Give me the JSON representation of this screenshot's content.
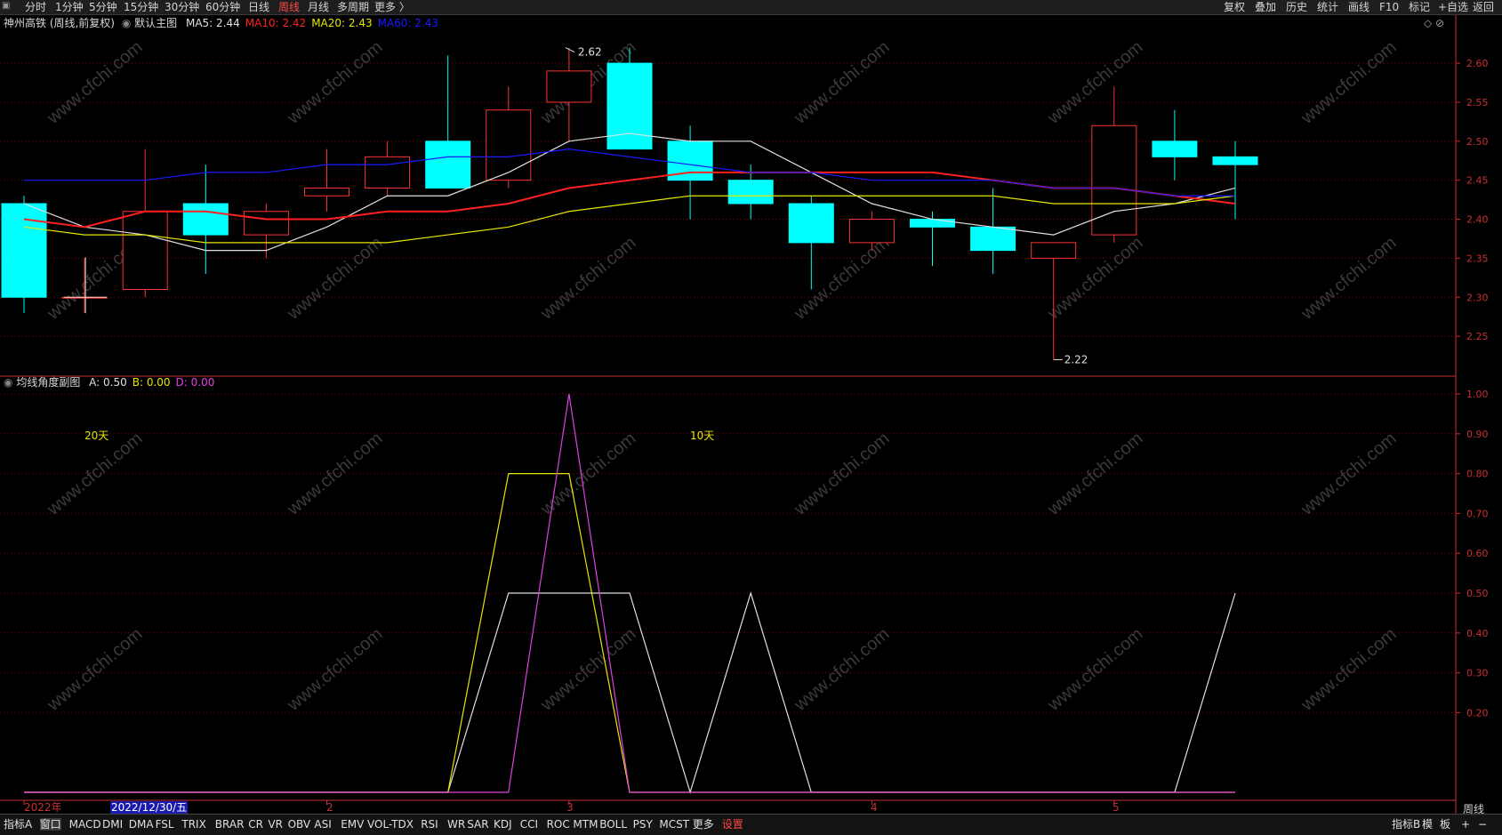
{
  "topbar": {
    "left_items": [
      "分时",
      "1分钟",
      "5分钟",
      "15分钟",
      "30分钟",
      "60分钟",
      "日线",
      "周线",
      "月线",
      "多周期",
      "更多 〉"
    ],
    "active": "周线",
    "right_items": [
      "复权",
      "叠加",
      "历史",
      "统计",
      "画线",
      "F10",
      "标记",
      "+自选",
      "返回"
    ]
  },
  "main_panel": {
    "stock_title": "神州高铁 (周线,前复权)",
    "indicator_name": "默认主图",
    "ma_values": [
      {
        "label": "MA5:",
        "value": "2.44",
        "color": "#e0e0e0"
      },
      {
        "label": "MA10:",
        "value": "2.42",
        "color": "#ff2020"
      },
      {
        "label": "MA20:",
        "value": "2.43",
        "color": "#e6e600"
      },
      {
        "label": "MA60:",
        "value": "2.43",
        "color": "#1a1aff"
      }
    ],
    "high_marker": "2.62",
    "low_marker": "2.22",
    "right_axis_icons": "◇ ⊘"
  },
  "sub_panel": {
    "indicator_name": "均线角度副图",
    "values": [
      {
        "label": "A:",
        "value": "0.50",
        "color": "#e0e0e0"
      },
      {
        "label": "B:",
        "value": "0.00",
        "color": "#e6e600"
      },
      {
        "label": "D:",
        "value": "0.00",
        "color": "#e040e0"
      }
    ],
    "annotations": [
      "20天",
      "10天"
    ]
  },
  "x_axis": {
    "labels": [
      {
        "text": "2022年",
        "color": "#c83030"
      },
      {
        "text": "2022/12/30/五",
        "color": "#ffffff",
        "selected": true
      },
      {
        "text": "2",
        "color": "#c83030"
      },
      {
        "text": "3",
        "color": "#c83030"
      },
      {
        "text": "4",
        "color": "#c83030"
      },
      {
        "text": "5",
        "color": "#c83030"
      }
    ],
    "period_label": "周线"
  },
  "bottom_tabs": [
    "指标A",
    "窗口",
    "MACD",
    "DMI",
    "DMA",
    "FSL",
    "TRIX",
    "BRAR",
    "CR",
    "VR",
    "OBV",
    "ASI",
    "EMV",
    "VOL-TDX",
    "RSI",
    "WR",
    "SAR",
    "KDJ",
    "CCI",
    "ROC",
    "MTM",
    "BOLL",
    "PSY",
    "MCST",
    "更多",
    "设置"
  ],
  "bottom_right": [
    "指标B",
    "模",
    "板",
    "+",
    "−"
  ],
  "watermark": "www.cfchi.com",
  "colors": {
    "up": "#ff3232",
    "down": "#00ffff",
    "grid": "#8b0000",
    "axis": "#c83030"
  },
  "chart_data": [
    {
      "type": "candlestick",
      "title": "神州高铁 (周线,前复权)",
      "ylim": [
        2.2,
        2.64
      ],
      "y_ticks": [
        "2.25",
        "2.30",
        "2.35",
        "2.40",
        "2.45",
        "2.50",
        "2.55",
        "2.60"
      ],
      "candles": [
        {
          "o": 2.42,
          "h": 2.43,
          "l": 2.28,
          "c": 2.3
        },
        {
          "o": 2.3,
          "h": 2.35,
          "l": 2.28,
          "c": 2.3
        },
        {
          "o": 2.31,
          "h": 2.49,
          "l": 2.3,
          "c": 2.41
        },
        {
          "o": 2.42,
          "h": 2.47,
          "l": 2.33,
          "c": 2.38
        },
        {
          "o": 2.38,
          "h": 2.42,
          "l": 2.35,
          "c": 2.41
        },
        {
          "o": 2.43,
          "h": 2.49,
          "l": 2.41,
          "c": 2.44
        },
        {
          "o": 2.44,
          "h": 2.5,
          "l": 2.43,
          "c": 2.48
        },
        {
          "o": 2.5,
          "h": 2.61,
          "l": 2.44,
          "c": 2.44
        },
        {
          "o": 2.45,
          "h": 2.57,
          "l": 2.44,
          "c": 2.54
        },
        {
          "o": 2.55,
          "h": 2.62,
          "l": 2.5,
          "c": 2.59
        },
        {
          "o": 2.6,
          "h": 2.62,
          "l": 2.49,
          "c": 2.49
        },
        {
          "o": 2.5,
          "h": 2.52,
          "l": 2.4,
          "c": 2.45
        },
        {
          "o": 2.45,
          "h": 2.47,
          "l": 2.4,
          "c": 2.42
        },
        {
          "o": 2.42,
          "h": 2.43,
          "l": 2.31,
          "c": 2.37
        },
        {
          "o": 2.37,
          "h": 2.41,
          "l": 2.36,
          "c": 2.4
        },
        {
          "o": 2.4,
          "h": 2.41,
          "l": 2.34,
          "c": 2.39
        },
        {
          "o": 2.39,
          "h": 2.44,
          "l": 2.33,
          "c": 2.36
        },
        {
          "o": 2.35,
          "h": 2.37,
          "l": 2.22,
          "c": 2.37
        },
        {
          "o": 2.38,
          "h": 2.57,
          "l": 2.37,
          "c": 2.52
        },
        {
          "o": 2.5,
          "h": 2.54,
          "l": 2.45,
          "c": 2.48
        },
        {
          "o": 2.48,
          "h": 2.5,
          "l": 2.4,
          "c": 2.47
        }
      ],
      "series": [
        {
          "name": "MA5",
          "color": "#e0e0e0",
          "values": [
            2.42,
            2.39,
            2.38,
            2.36,
            2.36,
            2.39,
            2.43,
            2.43,
            2.46,
            2.5,
            2.51,
            2.5,
            2.5,
            2.46,
            2.42,
            2.4,
            2.39,
            2.38,
            2.41,
            2.42,
            2.44
          ]
        },
        {
          "name": "MA10",
          "color": "#ff2020",
          "values": [
            2.4,
            2.39,
            2.41,
            2.41,
            2.4,
            2.4,
            2.41,
            2.41,
            2.42,
            2.44,
            2.45,
            2.46,
            2.46,
            2.46,
            2.46,
            2.46,
            2.45,
            2.44,
            2.44,
            2.43,
            2.42
          ]
        },
        {
          "name": "MA20",
          "color": "#e6e600",
          "values": [
            2.39,
            2.38,
            2.38,
            2.37,
            2.37,
            2.37,
            2.37,
            2.38,
            2.39,
            2.41,
            2.42,
            2.43,
            2.43,
            2.43,
            2.43,
            2.43,
            2.43,
            2.42,
            2.42,
            2.42,
            2.43
          ]
        },
        {
          "name": "MA60",
          "color": "#1a1aff",
          "values": [
            2.45,
            2.45,
            2.45,
            2.46,
            2.46,
            2.47,
            2.47,
            2.48,
            2.48,
            2.49,
            2.48,
            2.47,
            2.46,
            2.46,
            2.45,
            2.45,
            2.45,
            2.44,
            2.44,
            2.43,
            2.43
          ]
        }
      ]
    },
    {
      "type": "line",
      "title": "均线角度副图",
      "ylim": [
        0,
        1.0
      ],
      "y_ticks": [
        "0.20",
        "0.30",
        "0.40",
        "0.50",
        "0.60",
        "0.70",
        "0.80",
        "0.90",
        "1.00"
      ],
      "series": [
        {
          "name": "A",
          "color": "#e0e0e0",
          "values": [
            0,
            0,
            0,
            0,
            0,
            0,
            0,
            0,
            0.5,
            0.5,
            0.5,
            0,
            0.5,
            0,
            0,
            0,
            0,
            0,
            0,
            0,
            0.5
          ]
        },
        {
          "name": "B",
          "color": "#e6e600",
          "values": [
            0,
            0,
            0,
            0,
            0,
            0,
            0,
            0,
            0.8,
            0.8,
            0,
            0,
            0,
            0,
            0,
            0,
            0,
            0,
            0,
            0,
            0
          ]
        },
        {
          "name": "D",
          "color": "#e040e0",
          "values": [
            0,
            0,
            0,
            0,
            0,
            0,
            0,
            0,
            0,
            1.0,
            0,
            0,
            0,
            0,
            0,
            0,
            0,
            0,
            0,
            0,
            0
          ]
        }
      ]
    }
  ]
}
